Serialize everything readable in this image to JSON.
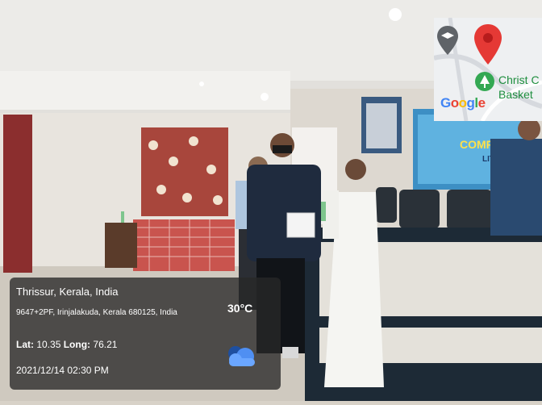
{
  "overlay": {
    "location": "Thrissur, Kerala, India",
    "address": "9647+2PF, Irinjalakuda, Kerala 680125, India",
    "temperature": "30°C",
    "lat_label": "Lat:",
    "lat_value": "10.35",
    "long_label": "Long:",
    "long_value": "76.21",
    "datetime": "2021/12/14 02:30 PM",
    "weather_icon": "cloud-icon"
  },
  "map": {
    "place_label_line1": "Christ C",
    "place_label_line2": "Basket",
    "logo": "Google",
    "pin_icon": "map-pin-icon",
    "school_icon": "school-icon",
    "tree_icon": "park-icon"
  },
  "scene": {
    "banner_text_1": "COMPU",
    "banner_text_2": "LITE"
  }
}
